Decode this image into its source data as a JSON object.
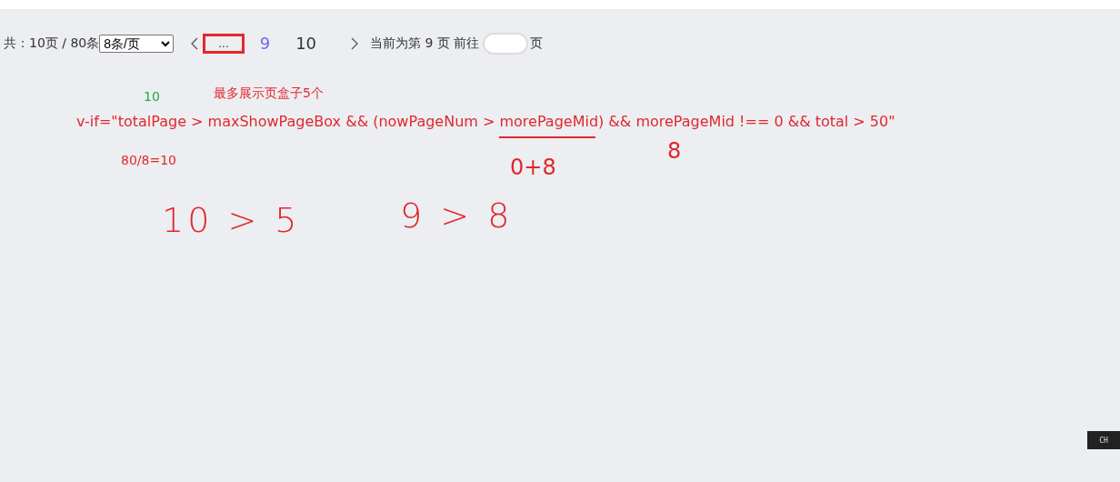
{
  "pagination": {
    "summary": "共：10页 / 80条",
    "page_size": {
      "value": "8条/页"
    },
    "pages": [
      {
        "label": "...",
        "kind": "ellipsis",
        "selected": false,
        "highlighted": true
      },
      {
        "label": "9",
        "kind": "page",
        "selected": true,
        "highlighted": false
      },
      {
        "label": "10",
        "kind": "page",
        "selected": false,
        "highlighted": false
      }
    ],
    "current_text": "当前为第 9 页 前往",
    "goto_suffix": "页"
  },
  "annotations": [
    {
      "kind": "note",
      "text": "10",
      "color": "#22aa44"
    },
    {
      "kind": "note",
      "text": "最多展示页盒子5个",
      "color": "#e0282e"
    },
    {
      "kind": "code",
      "text": "v-if=\"totalPage > maxShowPageBox && (nowPageNum > morePageMid) && morePageMid !== 0 && total > 50\"",
      "color": "#e0282e"
    },
    {
      "kind": "note",
      "text": "80/8=10",
      "color": "#e0282e"
    },
    {
      "kind": "big",
      "text": "0+8",
      "color": "#e0282e"
    },
    {
      "kind": "big",
      "text": "8",
      "color": "#e0282e"
    },
    {
      "kind": "handwritten",
      "text": "10 > 5",
      "color": "#e0282e"
    },
    {
      "kind": "handwritten",
      "text": "9 > 8",
      "color": "#e0282e"
    }
  ],
  "ime_badge": "CH"
}
